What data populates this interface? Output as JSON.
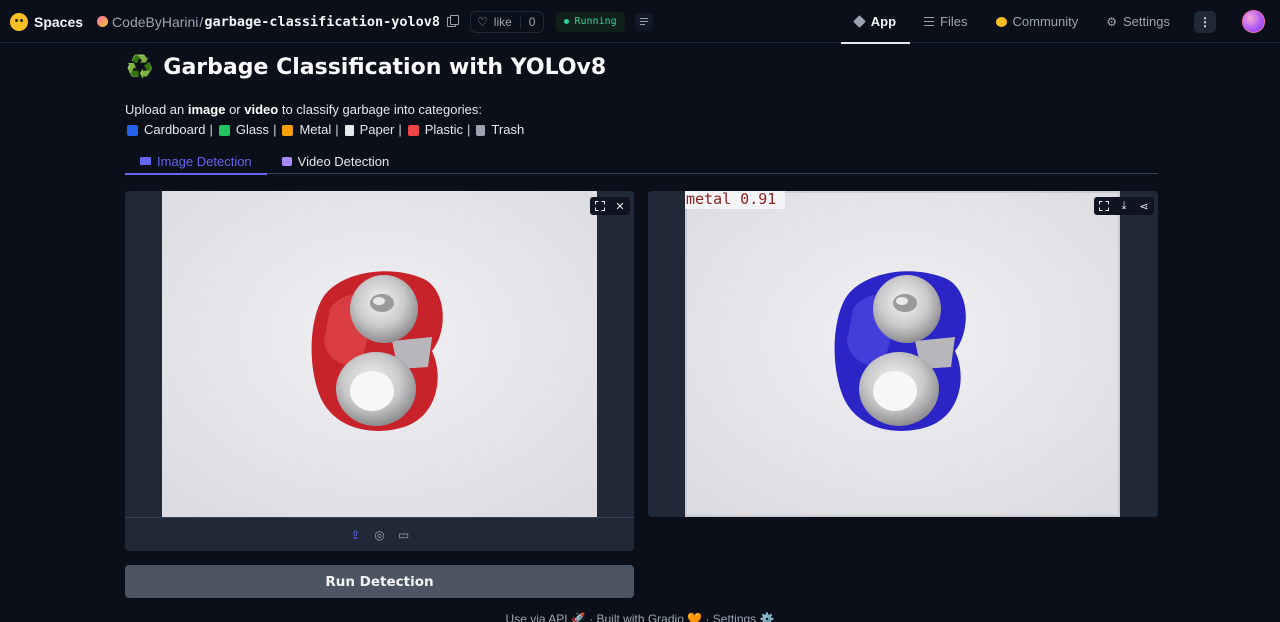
{
  "nav": {
    "spaces_label": "Spaces",
    "owner": "CodeByHarini",
    "separator": "/",
    "repo": "garbage-classification-yolov8",
    "like_label": "like",
    "like_count": "0",
    "status": "Running",
    "tabs": [
      {
        "label": "App"
      },
      {
        "label": "Files"
      },
      {
        "label": "Community"
      },
      {
        "label": "Settings"
      }
    ]
  },
  "page": {
    "title_icon": "♻️",
    "title": "Garbage Classification with YOLOv8",
    "desc_prefix": "Upload an ",
    "desc_image": "image",
    "desc_or": " or ",
    "desc_video": "video",
    "desc_suffix": " to classify garbage into categories:",
    "categories": [
      {
        "label": "Cardboard",
        "color": "#2563eb"
      },
      {
        "label": "Glass",
        "color": "#22c55e"
      },
      {
        "label": "Metal",
        "color": "#f59e0b"
      },
      {
        "label": "Paper",
        "color": "#e5e7eb"
      },
      {
        "label": "Plastic",
        "color": "#ef4444"
      },
      {
        "label": "Trash",
        "color": "#9ca3af"
      }
    ],
    "category_separator": "|"
  },
  "tabs": [
    {
      "label": "Image Detection"
    },
    {
      "label": "Video Detection"
    }
  ],
  "output": {
    "detection_label": "metal 0.91"
  },
  "run_button": "Run Detection",
  "footer": "Use via API 🚀 · Built with Gradio 🧡 · Settings ⚙️",
  "colors": {
    "background": "#0b0f19",
    "panel": "#1f2937",
    "accent": "#6366f1",
    "status": "#34d399"
  }
}
